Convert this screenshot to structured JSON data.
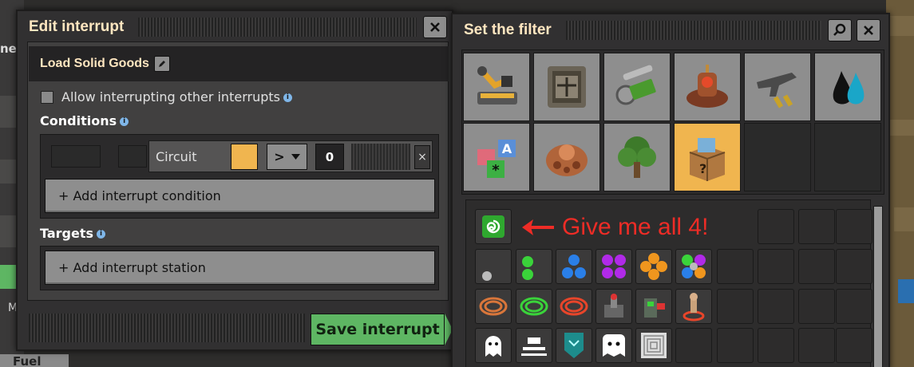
{
  "background": {
    "left_partial_text": "nec",
    "left_partial_text2": "M",
    "fuel_label": "Fuel"
  },
  "edit_window": {
    "title": "Edit interrupt",
    "close_icon": "close-icon",
    "interrupt_name": "Load Solid Goods",
    "edit_icon": "pencil-icon",
    "allow_interrupting": {
      "label": "Allow interrupting other interrupts",
      "checked": false
    },
    "conditions_label": "Conditions",
    "condition": {
      "signal_label": "Circuit",
      "signal_color": "#f0b54f",
      "comparator": ">",
      "value": "0",
      "remove_label": "×"
    },
    "add_condition_label": "+ Add interrupt condition",
    "targets_label": "Targets",
    "add_station_label": "+ Add interrupt station",
    "save_label": "Save interrupt",
    "accent_color": "#5eb663"
  },
  "filter_window": {
    "title": "Set the filter",
    "search_icon": "search-icon",
    "close_icon": "close-icon",
    "groups": [
      {
        "name": "logistics-group-icon",
        "selected": false
      },
      {
        "name": "production-group-icon",
        "selected": false
      },
      {
        "name": "intermediate-products-group-icon",
        "selected": false
      },
      {
        "name": "space-group-icon",
        "selected": false
      },
      {
        "name": "combat-group-icon",
        "selected": false
      },
      {
        "name": "fluids-group-icon",
        "selected": false
      },
      {
        "name": "signals-group-icon",
        "selected": false
      },
      {
        "name": "enemies-group-icon",
        "selected": false
      },
      {
        "name": "environment-group-icon",
        "selected": false
      },
      {
        "name": "unsorted-group-icon",
        "selected": true
      }
    ],
    "annotation": "Give me all 4!",
    "annotation_color": "#ee2c26",
    "item_rows": [
      [
        "circuit-chip-icon"
      ],
      [
        "one-dot-icon",
        "two-green-dots-icon",
        "three-blue-dots-icon",
        "four-purple-dots-icon",
        "four-orange-dots-icon",
        "four-mixed-dots-icon"
      ],
      [
        "copper-coil-icon",
        "green-coil-icon",
        "red-coil-icon",
        "control-box-icon",
        "fluid-box-icon",
        "pin-marker-icon"
      ],
      [
        "ghost-icon",
        "rail-icon",
        "shield-icon",
        "ghost-block-icon",
        "tile-pattern-icon"
      ]
    ]
  }
}
